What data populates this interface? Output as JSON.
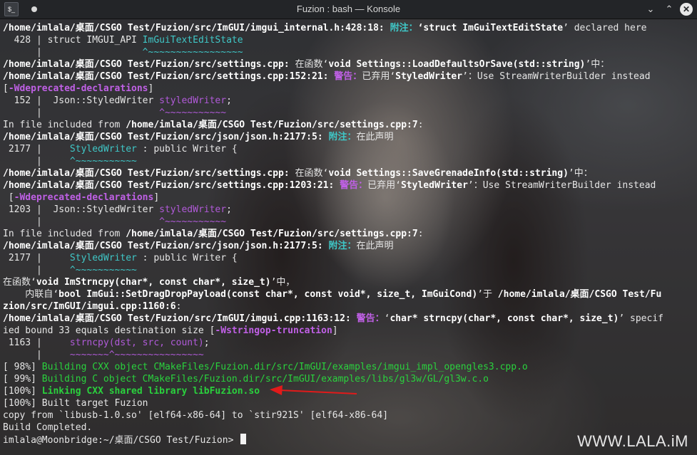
{
  "window": {
    "title": "Fuzion : bash — Konsole",
    "app_icon": "terminal-icon",
    "buttons": {
      "minimize": "⌄",
      "maximize": "⌃",
      "close": "✕"
    }
  },
  "colors": {
    "path_bold": "#ffffff",
    "note": "#3fc7c7",
    "warning": "#c060e6",
    "flag": "#b05ad8",
    "build_green": "#2ad13d",
    "arrow": "#e11a1a"
  },
  "terminal": {
    "lines": [
      [
        "/home/imlala/桌面/CSGO Test/Fuzion/src/ImGUI/imgui_internal.h:428:18: ",
        "附注：",
        "‘",
        "struct ImGuiTextEditState",
        "’ declared here"
      ],
      [
        "  428 | struct IMGUI_API ",
        "ImGuiTextEditState"
      ],
      [
        "      |                  ",
        "^~~~~~~~~~~~~~~~~~"
      ],
      [
        "/home/imlala/桌面/CSGO Test/Fuzion/src/settings.cpp:",
        " 在函数",
        "‘",
        "void Settings::LoadDefaultsOrSave(std::string)",
        "’中："
      ],
      [
        "/home/imlala/桌面/CSGO Test/Fuzion/src/settings.cpp:152:21: ",
        "警告：",
        "已弃用",
        "‘",
        "StyledWriter",
        "’：Use StreamWriterBuilder instead"
      ],
      [
        "[",
        "-Wdeprecated-declarations",
        "]"
      ],
      [
        "  152 |  Json::StyledWriter ",
        "styledWriter",
        ";"
      ],
      [
        "      |                     ",
        "^~~~~~~~~~~~"
      ],
      [
        "In file included from ",
        "/home/imlala/桌面/CSGO Test/Fuzion/src/settings.cpp:7",
        ":"
      ],
      [
        "/home/imlala/桌面/CSGO Test/Fuzion/src/json/json.h:2177:5: ",
        "附注：",
        "在此声明"
      ],
      [
        " 2177 |     ",
        "StyledWriter",
        " : public Writer {"
      ],
      [
        "      |     ",
        "^~~~~~~~~~~~"
      ],
      [
        "/home/imlala/桌面/CSGO Test/Fuzion/src/settings.cpp:",
        " 在函数",
        "‘",
        "void Settings::SaveGrenadeInfo(std::string)",
        "’中："
      ],
      [
        "/home/imlala/桌面/CSGO Test/Fuzion/src/settings.cpp:1203:21: ",
        "警告：",
        "已弃用",
        "‘",
        "StyledWriter",
        "’：Use StreamWriterBuilder instead"
      ],
      [
        " [",
        "-Wdeprecated-declarations",
        "]"
      ],
      [
        " 1203 |  Json::StyledWriter ",
        "styledWriter",
        ";"
      ],
      [
        "      |                     ",
        "^~~~~~~~~~~~"
      ],
      [
        "In file included from ",
        "/home/imlala/桌面/CSGO Test/Fuzion/src/settings.cpp:7",
        ":"
      ],
      [
        "/home/imlala/桌面/CSGO Test/Fuzion/src/json/json.h:2177:5: ",
        "附注：",
        "在此声明"
      ],
      [
        " 2177 |     ",
        "StyledWriter",
        " : public Writer {"
      ],
      [
        "      |     ",
        "^~~~~~~~~~~~"
      ],
      [
        "在函数",
        "‘",
        "void ImStrncpy(char*, const char*, size_t)",
        "’中，"
      ],
      [
        "    内联自",
        "‘",
        "bool ImGui::SetDragDropPayload(const char*, const void*, size_t, ImGuiCond)",
        "’于 ",
        "/home/imlala/桌面/CSGO Test/Fu"
      ],
      [
        "zion/src/ImGUI/imgui.cpp:1160:6",
        ":"
      ],
      [
        "/home/imlala/桌面/CSGO Test/Fuzion/src/ImGUI/imgui.cpp:1163:12: ",
        "警告：",
        "‘",
        "char* strncpy(char*, const char*, size_t)",
        "’ specif"
      ],
      [
        "ied bound 33 equals destination size [",
        "-Wstringop-truncation",
        "]"
      ],
      [
        " 1163 |     ",
        "strncpy(dst, src, count)",
        ";"
      ],
      [
        "      |     ",
        "~~~~~~~^~~~~~~~~~~~~~~~~"
      ],
      [
        "[ 98%] ",
        "Building CXX object CMakeFiles/Fuzion.dir/src/ImGUI/examples/imgui_impl_opengles3.cpp.o"
      ],
      [
        "[ 99%] ",
        "Building C object CMakeFiles/Fuzion.dir/src/ImGUI/examples/libs/gl3w/GL/gl3w.c.o"
      ],
      [
        "[100%] ",
        "Linking CXX shared library libFuzion.so"
      ],
      [
        "[100%] Built target Fuzion"
      ],
      [
        "copy from `libusb-1.0.so' [elf64-x86-64] to `stir921S' [elf64-x86-64]"
      ],
      [
        "Build Completed."
      ],
      [
        "imlala@Moonbridge:~/桌面/CSGO Test/Fuzion> "
      ]
    ]
  },
  "watermark": "WWW.LALA.iM"
}
